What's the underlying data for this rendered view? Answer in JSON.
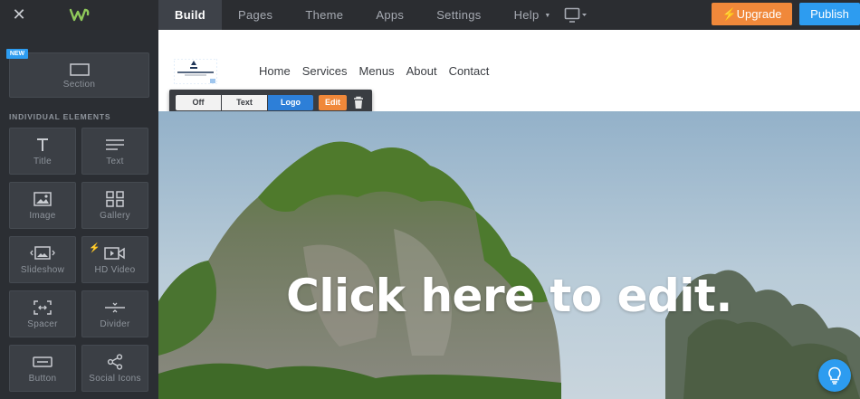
{
  "topbar": {
    "nav": [
      {
        "label": "Build",
        "active": true
      },
      {
        "label": "Pages",
        "active": false
      },
      {
        "label": "Theme",
        "active": false
      },
      {
        "label": "Apps",
        "active": false
      },
      {
        "label": "Settings",
        "active": false
      },
      {
        "label": "Help",
        "active": false
      }
    ],
    "upgrade_label": "Upgrade",
    "publish_label": "Publish",
    "colors": {
      "upgrade": "#f0883a",
      "publish": "#2d9cf0",
      "bar": "#2b2d31"
    }
  },
  "sidebar": {
    "new_badge": "NEW",
    "section_tile": {
      "label": "Section",
      "icon": "section-icon"
    },
    "section_heading": "INDIVIDUAL ELEMENTS",
    "elements": [
      {
        "label": "Title",
        "icon": "title-icon"
      },
      {
        "label": "Text",
        "icon": "text-icon"
      },
      {
        "label": "Image",
        "icon": "image-icon"
      },
      {
        "label": "Gallery",
        "icon": "gallery-icon"
      },
      {
        "label": "Slideshow",
        "icon": "slideshow-icon"
      },
      {
        "label": "HD Video",
        "icon": "hd-video-icon"
      },
      {
        "label": "Spacer",
        "icon": "spacer-icon"
      },
      {
        "label": "Divider",
        "icon": "divider-icon"
      },
      {
        "label": "Button",
        "icon": "button-icon"
      },
      {
        "label": "Social Icons",
        "icon": "social-icons-icon"
      }
    ]
  },
  "canvas": {
    "site_nav": [
      "Home",
      "Services",
      "Menus",
      "About",
      "Contact"
    ],
    "logo_toolbar": {
      "options": [
        "Off",
        "Text",
        "Logo"
      ],
      "selected": "Logo",
      "edit_label": "Edit"
    },
    "hero_title": "Click here to edit."
  }
}
